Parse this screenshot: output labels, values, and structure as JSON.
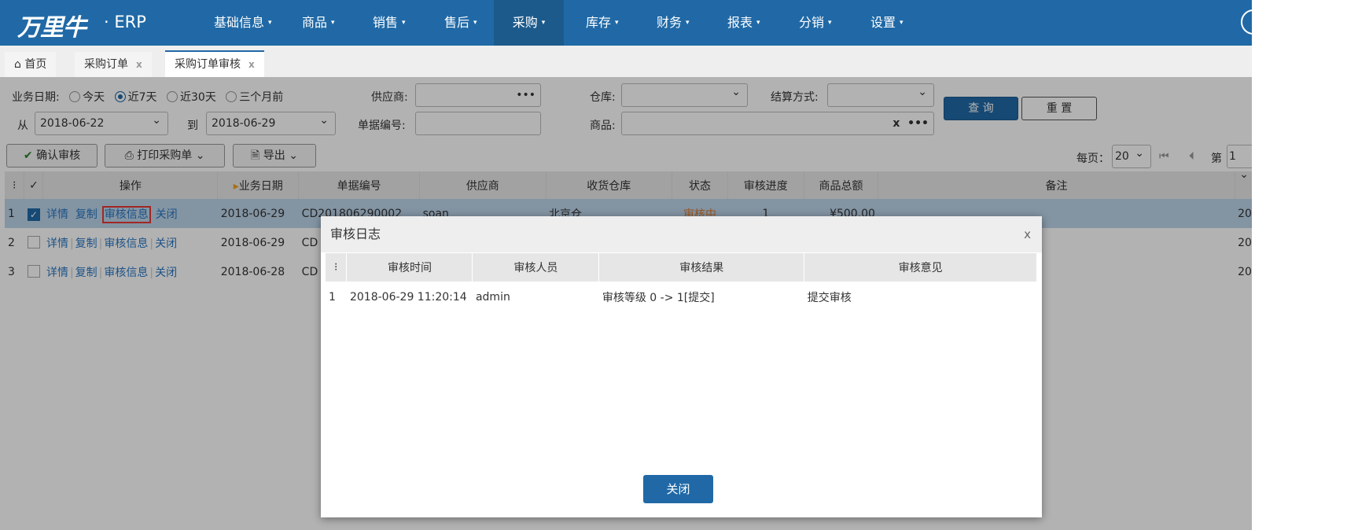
{
  "app": {
    "logo": "万里牛",
    "product": "· ERP"
  },
  "nav": [
    {
      "label": "基础信息"
    },
    {
      "label": "商品"
    },
    {
      "label": "销售"
    },
    {
      "label": "售后"
    },
    {
      "label": "采购",
      "active": true
    },
    {
      "label": "库存"
    },
    {
      "label": "财务"
    },
    {
      "label": "报表"
    },
    {
      "label": "分销"
    },
    {
      "label": "设置"
    }
  ],
  "tabs": [
    {
      "label": "首页"
    },
    {
      "label": "采购订单"
    },
    {
      "label": "采购订单审核",
      "active": true
    }
  ],
  "tab_close": "x",
  "filters": {
    "date_label": "业务日期:",
    "date_options": [
      "今天",
      "近7天",
      "近30天",
      "三个月前"
    ],
    "date_selected": "近7天",
    "from_label": "从",
    "from_value": "2018-06-22",
    "to_label": "到",
    "to_value": "2018-06-29",
    "supplier_label": "供应商:",
    "supplier_btn": "•••",
    "bill_no_label": "单据编号:",
    "warehouse_label": "仓库:",
    "product_label": "商品:",
    "product_clear": "x",
    "product_btn": "•••",
    "settle_label": "结算方式:",
    "query": "查 询",
    "reset": "重 置"
  },
  "toolbar": {
    "confirm": "确认审核",
    "print": "打印采购单",
    "export": "导出",
    "per_page_label": "每页：",
    "per_page": "20",
    "page_label": "第",
    "page": "1"
  },
  "table": {
    "headers": [
      "⁝",
      "✓",
      "操作",
      "业务日期",
      "单据编号",
      "供应商",
      "收货仓库",
      "状态",
      "审核进度",
      "商品总额",
      "备注",
      ""
    ],
    "actions": [
      "详情",
      "复制",
      "审核信息",
      "关闭"
    ],
    "rows": [
      {
        "idx": "1",
        "checked": true,
        "date": "2018-06-29",
        "no": "CD201806290002",
        "supplier": "soan",
        "warehouse": "北京仓",
        "status": "审核中",
        "progress": "1",
        "amount": "¥500.00",
        "tail": "20"
      },
      {
        "idx": "2",
        "checked": false,
        "date": "2018-06-29",
        "no": "CD",
        "tail": "20"
      },
      {
        "idx": "3",
        "checked": false,
        "date": "2018-06-28",
        "no": "CD",
        "tail": "20"
      }
    ]
  },
  "dialog": {
    "title": "审核日志",
    "close": "x",
    "headers": [
      "⁝",
      "审核时间",
      "审核人员",
      "审核结果",
      "审核意见"
    ],
    "rows": [
      {
        "idx": "1",
        "time": "2018-06-29 11:20:14",
        "user": "admin",
        "result": "审核等级 0 -> 1[提交]",
        "opinion": "提交审核"
      }
    ],
    "button": "关闭"
  },
  "colors": {
    "brand": "#2069a6",
    "highlight": "#e53935",
    "status": "#e07a2a"
  }
}
